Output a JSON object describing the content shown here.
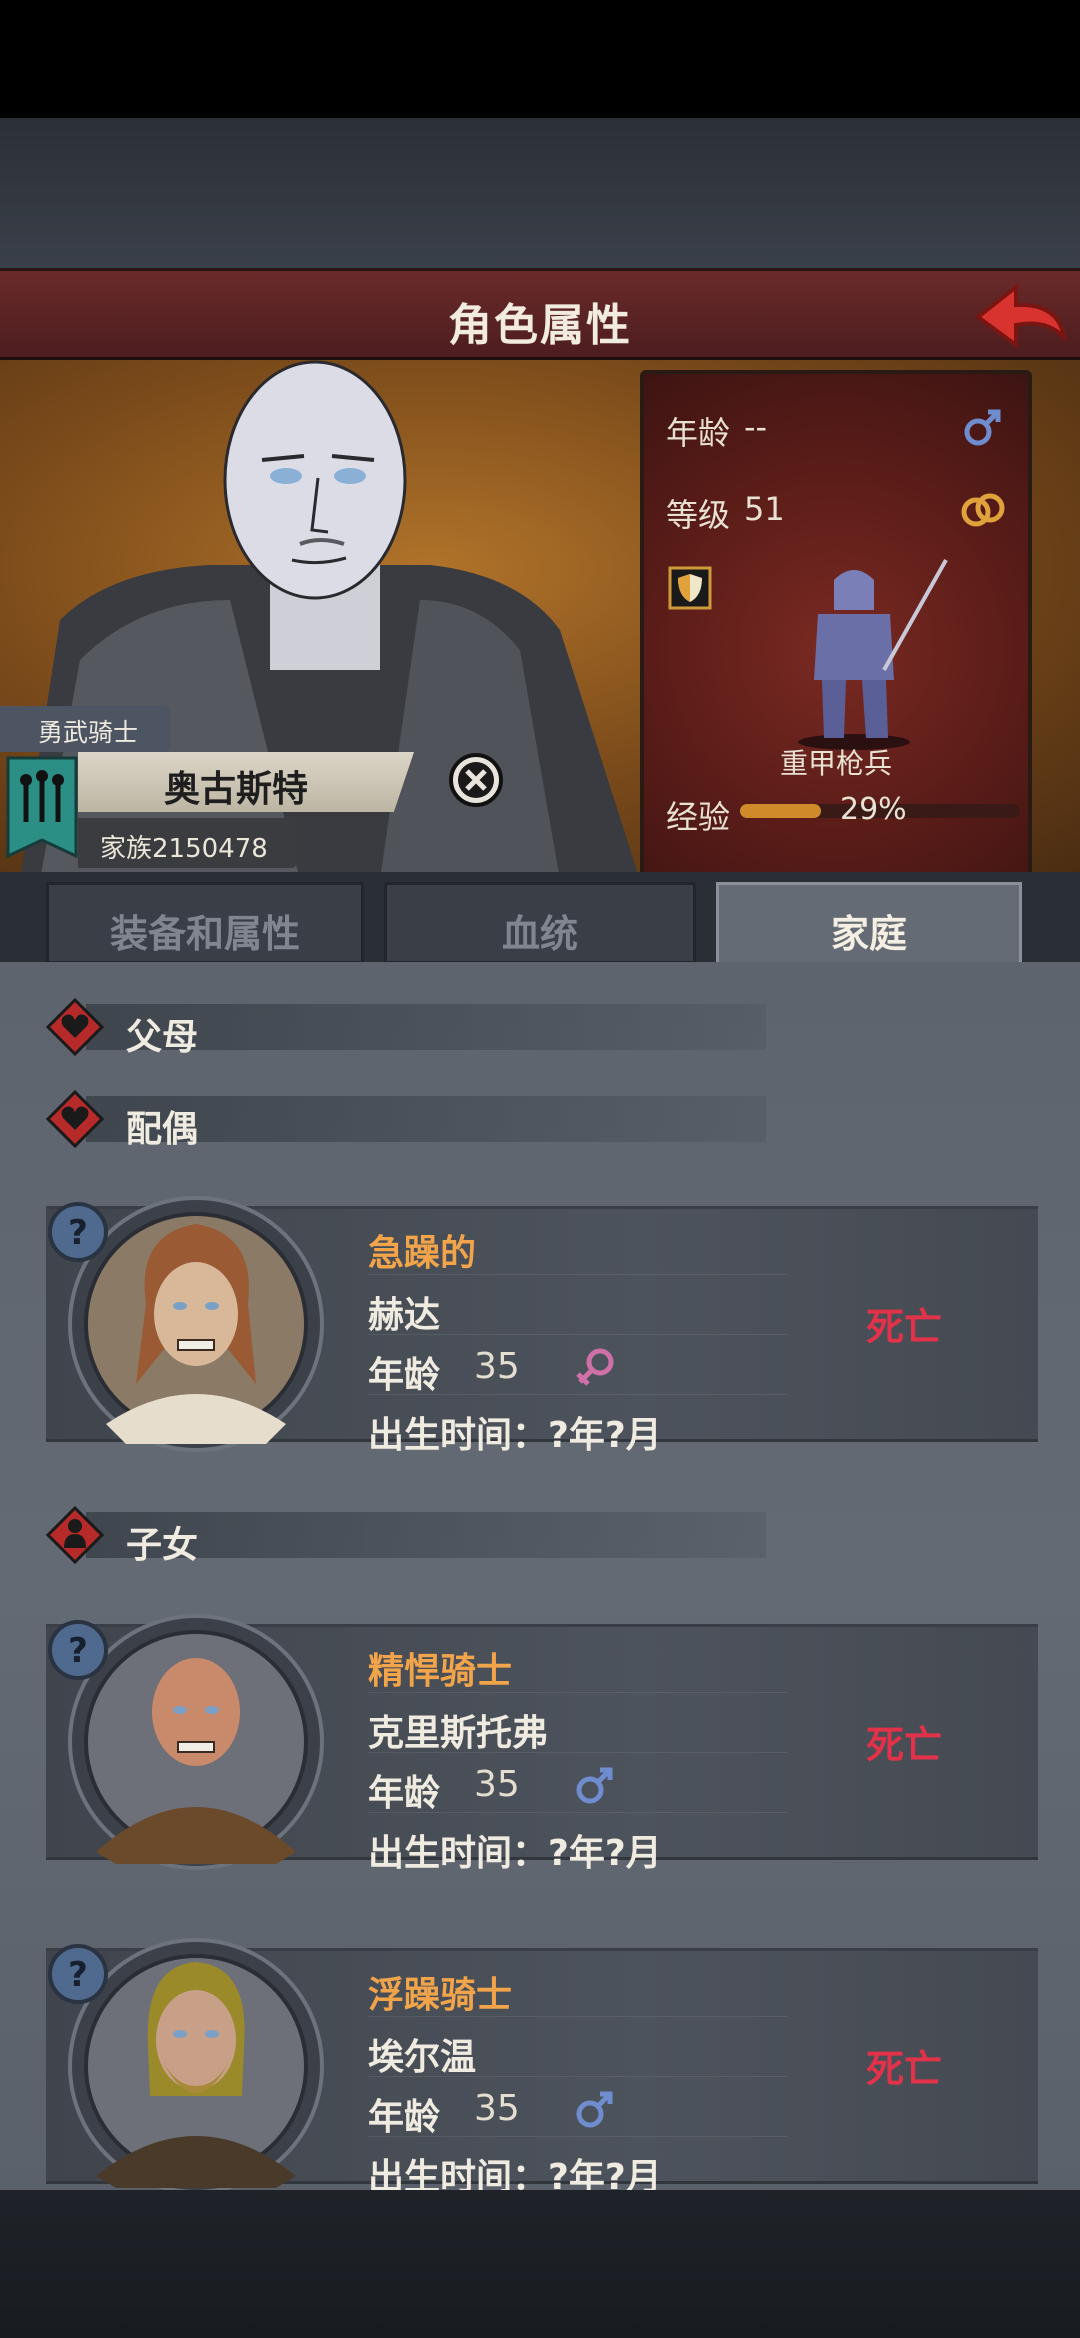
{
  "header": {
    "title": "角色属性"
  },
  "character": {
    "rank": "勇武骑士",
    "name": "奥古斯特",
    "family": "家族2150478"
  },
  "stats": {
    "age_label": "年龄",
    "age_value": "--",
    "level_label": "等级",
    "level_value": "51",
    "unit_name": "重甲枪兵",
    "exp_label": "经验",
    "exp_value": "29%",
    "exp_fraction": 0.29
  },
  "tabs": [
    {
      "label": "装备和属性",
      "active": false
    },
    {
      "label": "血统",
      "active": false
    },
    {
      "label": "家庭",
      "active": true
    }
  ],
  "sections": {
    "parents": "父母",
    "spouse": "配偶",
    "children": "子女"
  },
  "spouse_card": {
    "trait": "急躁的",
    "name": "赫达",
    "age_label": "年龄",
    "age": "35",
    "gender": "female",
    "birth": "出生时间：?年?月",
    "status": "死亡"
  },
  "children_cards": [
    {
      "trait": "精悍骑士",
      "name": "克里斯托弗",
      "age_label": "年龄",
      "age": "35",
      "gender": "male",
      "birth": "出生时间：?年?月",
      "status": "死亡"
    },
    {
      "trait": "浮躁骑士",
      "name": "埃尔温",
      "age_label": "年龄",
      "age": "35",
      "gender": "male",
      "birth": "出生时间：?年?月",
      "status": "死亡"
    }
  ],
  "colors": {
    "accent_title": "#5a2222",
    "trait_orange": "#f2a44a",
    "status_red": "#e2324a",
    "male_blue": "#6f8ccf",
    "female_pink": "#d070a8"
  }
}
